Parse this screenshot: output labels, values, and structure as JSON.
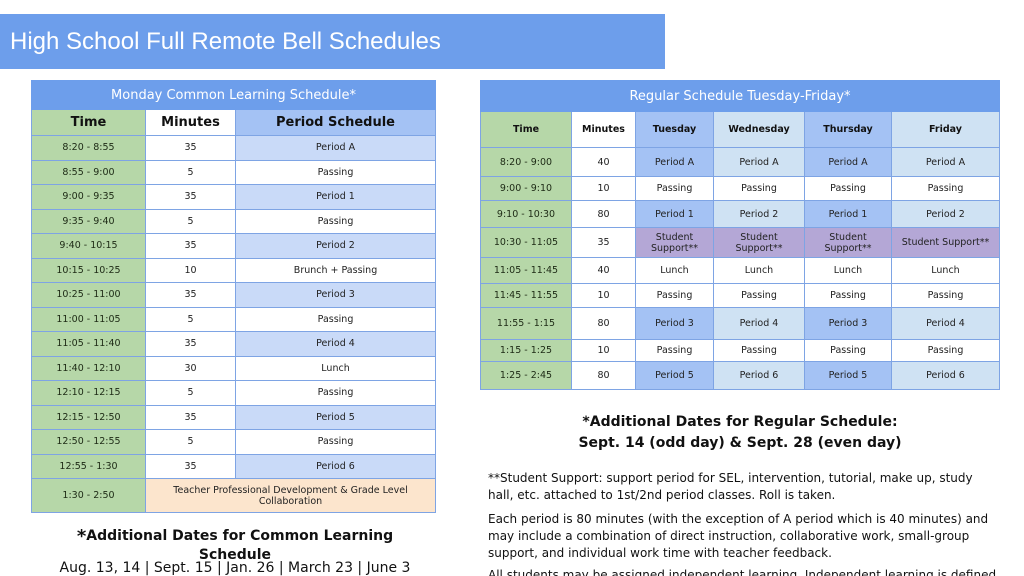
{
  "title": "High School Full Remote Bell Schedules",
  "colors": {
    "title_bar": "#6d9eeb",
    "time_column": "#b6d7a8",
    "period_light": "#c9daf8",
    "period_medium": "#a4c2f4",
    "period_pale": "#cfe2f3",
    "student_support": "#b4a7d6",
    "professional_development": "#fce5cd"
  },
  "monday": {
    "caption": "Monday Common Learning Schedule*",
    "headers": [
      "Time",
      "Minutes",
      "Period Schedule"
    ],
    "rows": [
      {
        "time": "8:20 - 8:55",
        "minutes": "35",
        "period": "Period A"
      },
      {
        "time": "8:55 - 9:00",
        "minutes": "5",
        "period": "Passing"
      },
      {
        "time": "9:00 - 9:35",
        "minutes": "35",
        "period": "Period 1"
      },
      {
        "time": "9:35 - 9:40",
        "minutes": "5",
        "period": "Passing"
      },
      {
        "time": "9:40 - 10:15",
        "minutes": "35",
        "period": "Period 2"
      },
      {
        "time": "10:15 - 10:25",
        "minutes": "10",
        "period": "Brunch + Passing"
      },
      {
        "time": "10:25 - 11:00",
        "minutes": "35",
        "period": "Period 3"
      },
      {
        "time": "11:00 - 11:05",
        "minutes": "5",
        "period": "Passing"
      },
      {
        "time": "11:05 - 11:40",
        "minutes": "35",
        "period": "Period 4"
      },
      {
        "time": "11:40 - 12:10",
        "minutes": "30",
        "period": "Lunch"
      },
      {
        "time": "12:10 - 12:15",
        "minutes": "5",
        "period": "Passing"
      },
      {
        "time": "12:15 - 12:50",
        "minutes": "35",
        "period": "Period 5"
      },
      {
        "time": "12:50 - 12:55",
        "minutes": "5",
        "period": "Passing"
      },
      {
        "time": "12:55 - 1:30",
        "minutes": "35",
        "period": "Period 6"
      },
      {
        "time": "1:30 - 2:50",
        "merged": "Teacher Professional Development & Grade Level Collaboration"
      }
    ],
    "note_title": "Additional Dates for Common Learning Schedule",
    "note_star": "*",
    "note_dates": "Aug. 13, 14 | Sept. 15 | Jan. 26 | March 23 | June 3"
  },
  "regular": {
    "caption": "Regular Schedule Tuesday-Friday*",
    "headers": [
      "Time",
      "Minutes",
      "Tuesday",
      "Wednesday",
      "Thursday",
      "Friday"
    ],
    "rows": [
      {
        "time": "8:20 - 9:00",
        "minutes": "40",
        "days": [
          "Period A",
          "Period A",
          "Period A",
          "Period A"
        ]
      },
      {
        "time": "9:00 - 9:10",
        "minutes": "10",
        "days": [
          "Passing",
          "Passing",
          "Passing",
          "Passing"
        ]
      },
      {
        "time": "9:10 - 10:30",
        "minutes": "80",
        "days": [
          "Period 1",
          "Period 2",
          "Period 1",
          "Period 2"
        ]
      },
      {
        "time": "10:30 - 11:05",
        "minutes": "35",
        "days": [
          "Student Support**",
          "Student Support**",
          "Student Support**",
          "Student Support**"
        ]
      },
      {
        "time": "11:05 - 11:45",
        "minutes": "40",
        "days": [
          "Lunch",
          "Lunch",
          "Lunch",
          "Lunch"
        ]
      },
      {
        "time": "11:45 - 11:55",
        "minutes": "10",
        "days": [
          "Passing",
          "Passing",
          "Passing",
          "Passing"
        ]
      },
      {
        "time": "11:55 - 1:15",
        "minutes": "80",
        "days": [
          "Period 3",
          "Period 4",
          "Period 3",
          "Period 4"
        ]
      },
      {
        "time": "1:15 - 1:25",
        "minutes": "10",
        "days": [
          "Passing",
          "Passing",
          "Passing",
          "Passing"
        ]
      },
      {
        "time": "1:25 - 2:45",
        "minutes": "80",
        "days": [
          "Period 5",
          "Period 6",
          "Period 5",
          "Period 6"
        ]
      }
    ],
    "note_title_line1": "*Additional Dates for Regular Schedule:",
    "note_title_line2": "Sept. 14 (odd day) & Sept. 28 (even day)",
    "student_support_note": "**Student Support: support period for SEL, intervention, tutorial, make up, study hall, etc. attached to 1st/2nd period classes. Roll is taken.",
    "each_period_note": "Each period is 80 minutes (with the exception of A period which is 40 minutes) and may include a combination of direct instruction, collaborative work, small-group support, and individual work time with teacher feedback.",
    "independent_learning_note": "All students may be assigned independent learning. Independent learning is defined as"
  }
}
